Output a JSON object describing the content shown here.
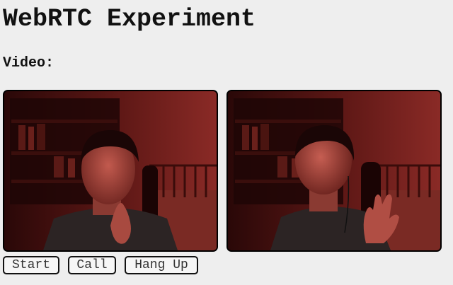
{
  "page": {
    "title": "WebRTC Experiment",
    "video_label": "Video:"
  },
  "videos": [
    {
      "id": "local",
      "name": "local-video"
    },
    {
      "id": "remote",
      "name": "remote-video"
    }
  ],
  "controls": {
    "start_label": "Start",
    "call_label": "Call",
    "hangup_label": "Hang Up"
  },
  "colors": {
    "background": "#eeeeee",
    "video_tint": "#7a1f1c",
    "border": "#000000"
  }
}
